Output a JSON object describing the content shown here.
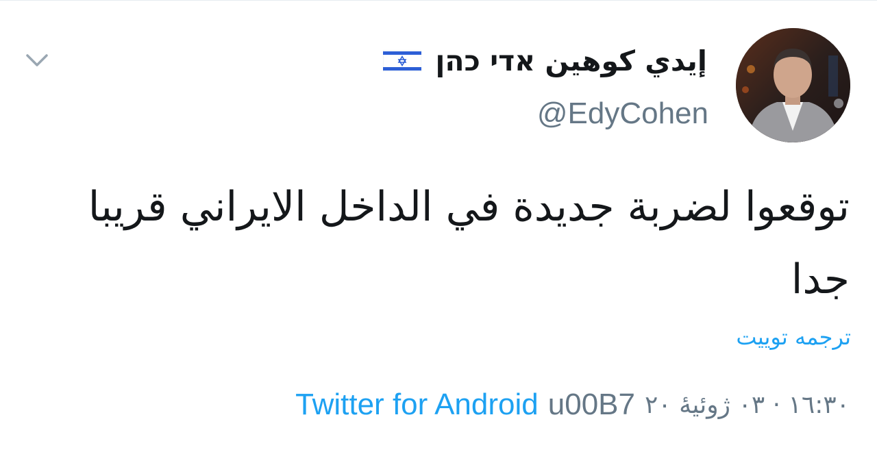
{
  "tweet": {
    "display_name": "إيدي كوهين אדי כהן",
    "handle": "@EdyCohen",
    "text": "توقعوا لضربة جديدة في الداخل الايراني قريبا جدا",
    "translate_label": "ترجمه توييت",
    "timestamp": "١٦:٣٠ · ٠٣ ژوئیهٔ ٢٠",
    "separator": "u00B7",
    "source": "Twitter for Android",
    "flag_icon": "israel-flag-icon",
    "menu_icon": "chevron-down-icon"
  },
  "colors": {
    "link": "#1da1f2",
    "muted": "#657786",
    "text": "#14171a",
    "flag_blue": "#2d5fd6"
  }
}
